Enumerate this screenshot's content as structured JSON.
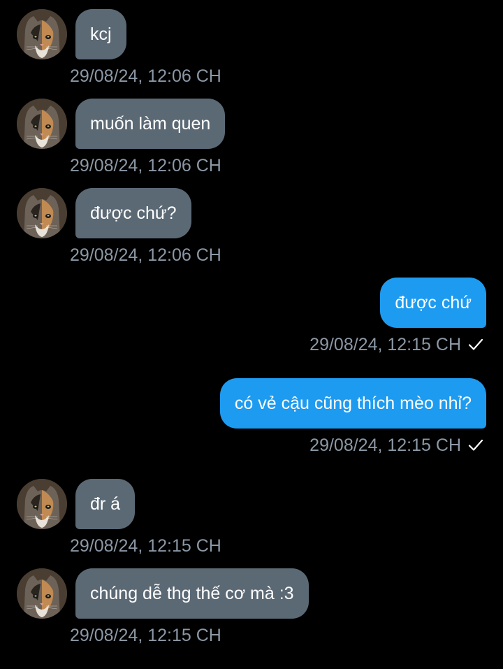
{
  "messages": [
    {
      "direction": "in",
      "text": "kcj",
      "time": "29/08/24, 12:06 CH"
    },
    {
      "direction": "in",
      "text": "muốn làm quen",
      "time": "29/08/24, 12:06 CH"
    },
    {
      "direction": "in",
      "text": "được chứ?",
      "time": "29/08/24, 12:06 CH"
    },
    {
      "direction": "out",
      "text": "được chứ",
      "time": "29/08/24, 12:15 CH",
      "status_icon": "check-icon"
    },
    {
      "direction": "out",
      "text": "có vẻ cậu cũng thích mèo nhỉ?",
      "time": "29/08/24, 12:15 CH",
      "status_icon": "check-icon"
    },
    {
      "direction": "in",
      "text": "đr á",
      "time": "29/08/24, 12:15 CH"
    },
    {
      "direction": "in",
      "text": "chúng dễ thg thế cơ mà :3",
      "time": "29/08/24, 12:15 CH"
    }
  ],
  "colors": {
    "background": "#000000",
    "incoming_bubble": "#5b6975",
    "outgoing_bubble": "#1d9bf0",
    "timestamp": "#8b98a5"
  },
  "avatar_icon": "cat-avatar-icon"
}
